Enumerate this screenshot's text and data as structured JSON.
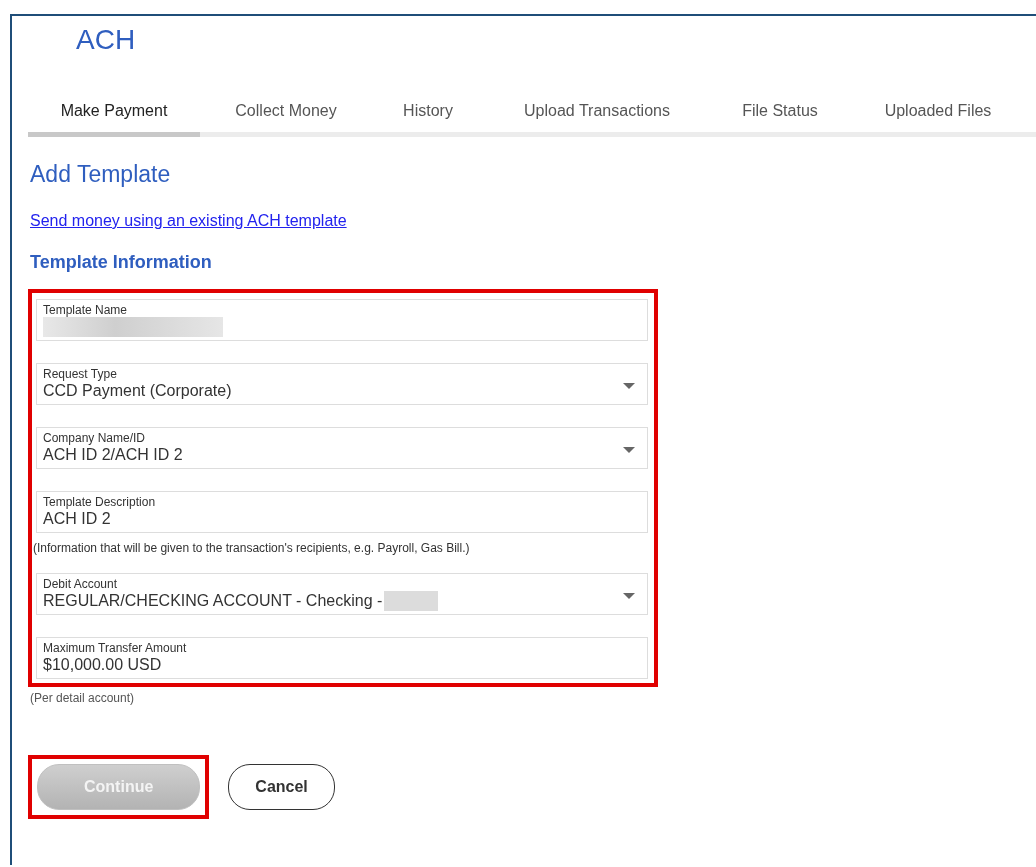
{
  "app_title": "ACH",
  "tabs": [
    {
      "label": "Make Payment",
      "selected": true
    },
    {
      "label": "Collect Money",
      "selected": false
    },
    {
      "label": "History",
      "selected": false
    },
    {
      "label": "Upload Transactions",
      "selected": false
    },
    {
      "label": "File Status",
      "selected": false
    },
    {
      "label": "Uploaded Files",
      "selected": false
    }
  ],
  "page_title": "Add Template",
  "template_link": "Send money using an existing ACH template",
  "section_title": "Template Information",
  "form": {
    "highlighted": true,
    "fields": [
      {
        "kind": "text",
        "label": "Template Name",
        "redacted": true
      },
      {
        "kind": "select",
        "label": "Request Type",
        "value": "CCD Payment (Corporate)",
        "redacted": false
      },
      {
        "kind": "select",
        "label": "Company Name/ID",
        "value": "ACH ID 2/ACH ID 2",
        "redacted": false
      },
      {
        "kind": "text",
        "label": "Template Description",
        "value": "ACH ID 2",
        "redacted": false,
        "hint": "(Information that will be given to the transaction's recipients, e.g. Payroll, Gas Bill.)"
      },
      {
        "kind": "select",
        "label": "Debit Account",
        "value": "REGULAR/CHECKING ACCOUNT - Checking -",
        "redacted": true
      },
      {
        "kind": "text",
        "label": "Maximum Transfer Amount",
        "value": "$10,000.00 USD",
        "redacted": false
      }
    ],
    "footnote": "(Per detail account)"
  },
  "buttons": [
    {
      "kind": "primary",
      "label": "Continue",
      "disabled": true,
      "highlighted": true
    },
    {
      "kind": "secondary",
      "label": "Cancel",
      "disabled": false,
      "highlighted": false
    }
  ]
}
